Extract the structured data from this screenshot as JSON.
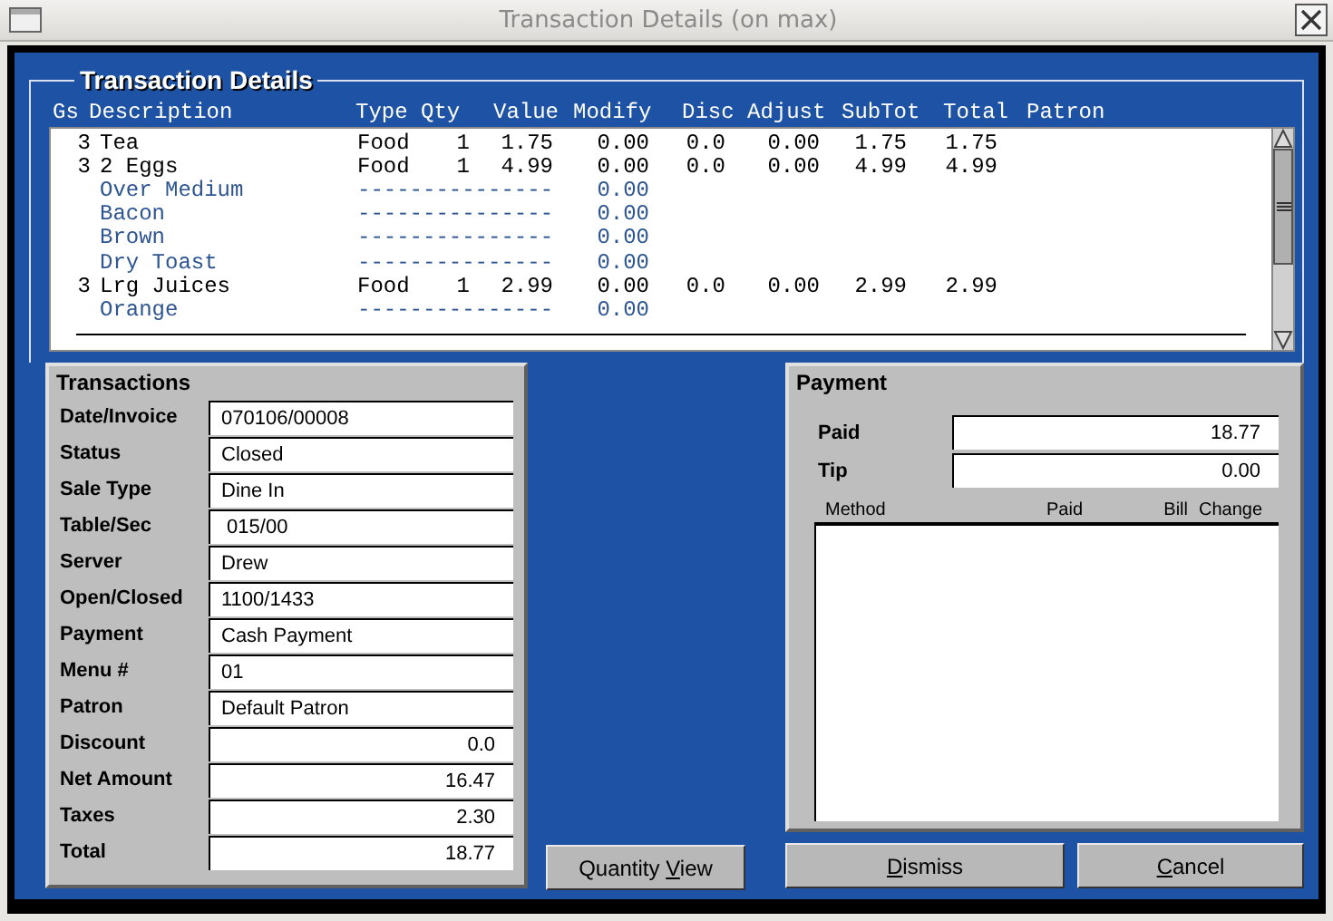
{
  "window": {
    "title": "Transaction Details (on max)"
  },
  "group_title": "Transaction Details",
  "columns": [
    "Gs",
    "Description",
    "Type",
    "Qty",
    "Value",
    "Modify",
    "Disc",
    "Adjust",
    "SubTot",
    "Total",
    "Patron"
  ],
  "items": [
    {
      "kind": "item",
      "gs": "3",
      "description": "Tea",
      "type": "Food",
      "qty": "1",
      "value": "1.75",
      "modify": "0.00",
      "disc": "0.0",
      "adjust": "0.00",
      "subtot": "1.75",
      "total": "1.75"
    },
    {
      "kind": "item",
      "gs": "3",
      "description": "2 Eggs",
      "type": "Food",
      "qty": "1",
      "value": "4.99",
      "modify": "0.00",
      "disc": "0.0",
      "adjust": "0.00",
      "subtot": "4.99",
      "total": "4.99"
    },
    {
      "kind": "modifier",
      "description": "Over Medium",
      "dashes": "---------------",
      "modify": "0.00"
    },
    {
      "kind": "modifier",
      "description": "Bacon",
      "dashes": "---------------",
      "modify": "0.00"
    },
    {
      "kind": "modifier",
      "description": "Brown",
      "dashes": "---------------",
      "modify": "0.00"
    },
    {
      "kind": "modifier",
      "description": "Dry Toast",
      "dashes": "---------------",
      "modify": "0.00"
    },
    {
      "kind": "item",
      "gs": "3",
      "description": "Lrg Juices",
      "type": "Food",
      "qty": "1",
      "value": "2.99",
      "modify": "0.00",
      "disc": "0.0",
      "adjust": "0.00",
      "subtot": "2.99",
      "total": "2.99"
    },
    {
      "kind": "modifier",
      "description": "Orange",
      "dashes": "---------------",
      "modify": "0.00"
    }
  ],
  "transactions": {
    "title": "Transactions",
    "fields": [
      {
        "label": "Date/Invoice",
        "value": "070106/00008",
        "kind": "text"
      },
      {
        "label": "Status",
        "value": "Closed",
        "kind": "text"
      },
      {
        "label": "Sale Type",
        "value": "Dine In",
        "kind": "text"
      },
      {
        "label": "Table/Sec",
        "value": " 015/00",
        "kind": "text"
      },
      {
        "label": "Server",
        "value": "Drew",
        "kind": "text"
      },
      {
        "label": "Open/Closed",
        "value": "1100/1433",
        "kind": "text"
      },
      {
        "label": "Payment",
        "value": "Cash Payment",
        "kind": "text"
      },
      {
        "label": "Menu #",
        "value": "01",
        "kind": "text"
      },
      {
        "label": "Patron",
        "value": "Default Patron",
        "kind": "text"
      },
      {
        "label": "Discount",
        "value": "0.0",
        "kind": "amount"
      },
      {
        "label": "Net Amount",
        "value": "16.47",
        "kind": "amount"
      },
      {
        "label": "Taxes",
        "value": "2.30",
        "kind": "amount"
      },
      {
        "label": "Total",
        "value": "18.77",
        "kind": "amount"
      }
    ]
  },
  "payment": {
    "title": "Payment",
    "fields": [
      {
        "label": "Paid",
        "value": "18.77"
      },
      {
        "label": "Tip",
        "value": "0.00"
      }
    ],
    "columns": [
      "Method",
      "Paid",
      "Bill",
      "Change"
    ]
  },
  "buttons": [
    {
      "before": "Quantity ",
      "key": "V",
      "after": "iew",
      "kind": "quantity"
    },
    {
      "key": "D",
      "after": "ismiss",
      "kind": "dismiss"
    },
    {
      "key": "C",
      "after": "ancel",
      "kind": "cancel"
    }
  ]
}
